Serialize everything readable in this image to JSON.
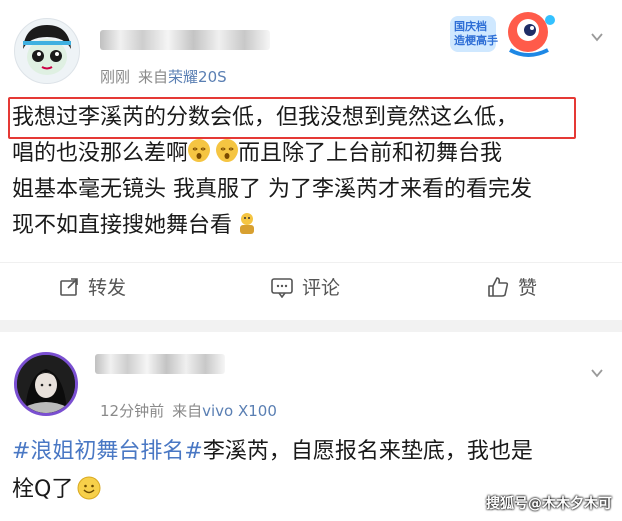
{
  "post1": {
    "time": "刚刚",
    "source_prefix": "来自",
    "source_device": "荣耀20S",
    "badge_line1": "国庆档",
    "badge_line2": "造梗高手",
    "line1": "我想过李溪芮的分数会低，但我没想到竟然这么低，",
    "line2a": "唱的也没那么差啊",
    "line2b": "而且除了上台前和初舞台我",
    "line3": "姐基本毫无镜头 我真服了 为了李溪芮才来看的看完发",
    "line4": "现不如直接搜她舞台看",
    "actions": {
      "repost": "转发",
      "comment": "评论",
      "like": "赞"
    }
  },
  "post2": {
    "time": "12分钟前",
    "source_prefix": "来自",
    "source_device": "vivo X100",
    "hashtag": "#浪姐初舞台排名#",
    "line1_rest": "李溪芮，自愿报名来垫底，我也是",
    "line2": "栓Q了"
  },
  "watermark": "搜狐号@木木夕木可",
  "colors": {
    "highlight": "#e53935",
    "hashtag": "#4a78c4",
    "source": "#5a7fb3",
    "meta": "#8a8a8a"
  },
  "icons": [
    "chevron-down-icon",
    "share-icon",
    "comment-icon",
    "thumbs-up-icon",
    "dizzy-face-emoji",
    "smile-emoji"
  ]
}
